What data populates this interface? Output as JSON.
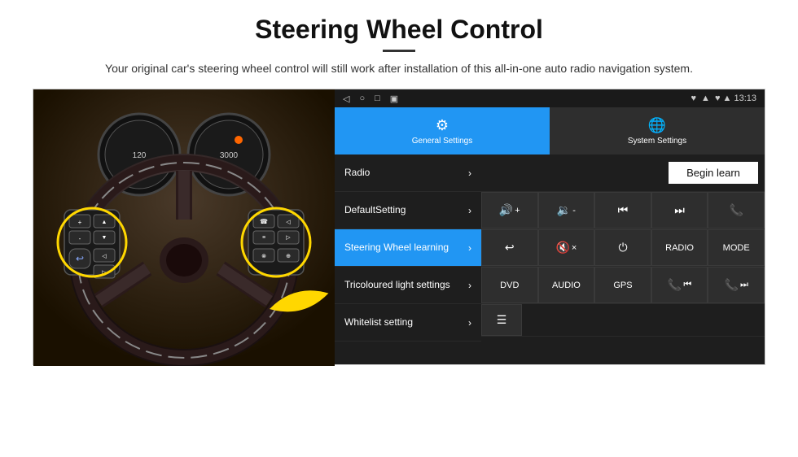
{
  "header": {
    "title": "Steering Wheel Control",
    "divider": true,
    "subtitle": "Your original car's steering wheel control will still work after installation of this all-in-one auto radio navigation system."
  },
  "statusBar": {
    "icons": [
      "◁",
      "○",
      "□",
      "▣"
    ],
    "rightText": "♥ ▲ 13:13"
  },
  "tabs": [
    {
      "id": "general",
      "label": "General Settings",
      "icon": "⚙",
      "active": true
    },
    {
      "id": "system",
      "label": "System Settings",
      "icon": "🌐",
      "active": false
    }
  ],
  "menu": [
    {
      "id": "radio",
      "label": "Radio",
      "active": false
    },
    {
      "id": "defaultsetting",
      "label": "DefaultSetting",
      "active": false
    },
    {
      "id": "steeringwheel",
      "label": "Steering Wheel learning",
      "active": true
    },
    {
      "id": "tricoloured",
      "label": "Tricoloured light settings",
      "active": false
    },
    {
      "id": "whitelist",
      "label": "Whitelist setting",
      "active": false
    }
  ],
  "rightPanel": {
    "beginLearnLabel": "Begin learn",
    "buttonRows": [
      [
        {
          "id": "vol-up",
          "label": "🔊+",
          "type": "icon"
        },
        {
          "id": "vol-down",
          "label": "🔉-",
          "type": "icon"
        },
        {
          "id": "prev-track",
          "label": "⏮",
          "type": "icon"
        },
        {
          "id": "next-track",
          "label": "⏭",
          "type": "icon"
        },
        {
          "id": "phone",
          "label": "📞",
          "type": "icon"
        }
      ],
      [
        {
          "id": "hang-up",
          "label": "↩",
          "type": "icon"
        },
        {
          "id": "mute",
          "label": "🔇×",
          "type": "icon"
        },
        {
          "id": "power",
          "label": "⏻",
          "type": "icon"
        },
        {
          "id": "radio-btn",
          "label": "RADIO",
          "type": "text"
        },
        {
          "id": "mode-btn",
          "label": "MODE",
          "type": "text"
        }
      ],
      [
        {
          "id": "dvd-btn",
          "label": "DVD",
          "type": "text"
        },
        {
          "id": "audio-btn",
          "label": "AUDIO",
          "type": "text"
        },
        {
          "id": "gps-btn",
          "label": "GPS",
          "type": "text"
        },
        {
          "id": "tel-prev",
          "label": "📞⏮",
          "type": "icon"
        },
        {
          "id": "tel-next",
          "label": "📞⏭",
          "type": "icon"
        }
      ]
    ],
    "lastRow": [
      {
        "id": "list-icon",
        "label": "☰",
        "type": "icon"
      }
    ]
  }
}
